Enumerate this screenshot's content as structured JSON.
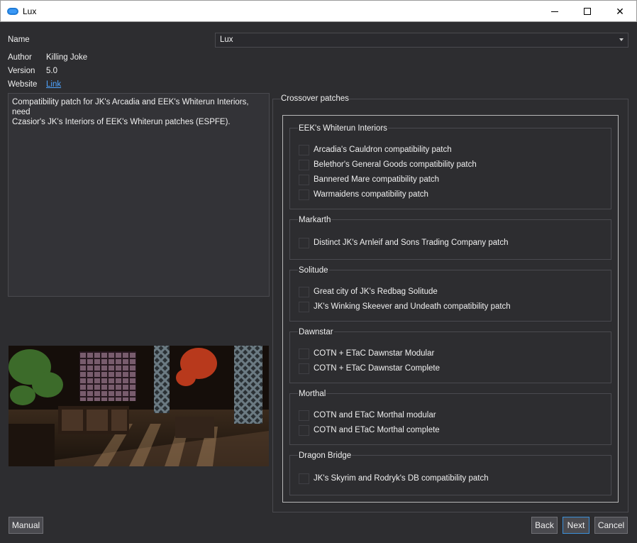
{
  "window": {
    "title": "Lux",
    "minimize_label": "",
    "maximize_label": "",
    "close_label": "✕"
  },
  "info": {
    "name_label": "Name",
    "name_value": "Lux",
    "author_label": "Author",
    "author_value": "Killing Joke",
    "version_label": "Version",
    "version_value": "5.0",
    "website_label": "Website",
    "website_link": "Link"
  },
  "description": {
    "line1": "Compatibility patch for JK's Arcadia and EEK's Whiterun Interiors, need",
    "line2": "Czasior's JK's Interiors of EEK's Whiterun patches (ESPFE)."
  },
  "crossover": {
    "title": "Crossover patches",
    "groups": [
      {
        "title": "EEK's Whiterun Interiors",
        "options": [
          "Arcadia's Cauldron compatibility patch",
          "Belethor's General Goods compatibility patch",
          "Bannered Mare compatibility patch",
          "Warmaidens compatibility patch"
        ]
      },
      {
        "title": "Markarth",
        "options": [
          "Distinct JK's Arnleif and Sons Trading Company patch"
        ]
      },
      {
        "title": "Solitude",
        "options": [
          "Great city of JK's Redbag Solitude",
          "JK's Winking Skeever and Undeath compatibility patch"
        ]
      },
      {
        "title": "Dawnstar",
        "options": [
          "COTN + ETaC Dawnstar Modular",
          "COTN + ETaC Dawnstar Complete"
        ]
      },
      {
        "title": "Morthal",
        "options": [
          "COTN and ETaC Morthal modular",
          "COTN and ETaC Morthal complete"
        ]
      },
      {
        "title": "Dragon Bridge",
        "options": [
          "JK's Skyrim and Rodryk's DB compatibility patch"
        ]
      }
    ]
  },
  "buttons": {
    "manual": "Manual",
    "back": "Back",
    "next": "Next",
    "cancel": "Cancel"
  },
  "colors": {
    "background": "#2d2d30",
    "accent": "#3c8fd8",
    "link": "#4ea3ff"
  }
}
